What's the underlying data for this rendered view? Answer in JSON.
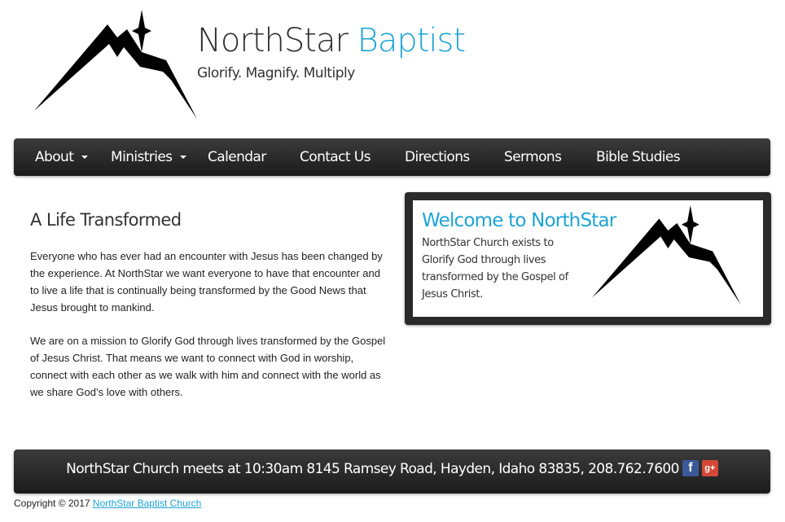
{
  "header": {
    "title_main": "NorthStar",
    "title_accent": "Baptist",
    "tagline": "Glorify. Magnify. Multiply",
    "logo_icon": "mountain-star-logo-icon"
  },
  "nav": {
    "items": [
      {
        "label": "About",
        "has_dropdown": true
      },
      {
        "label": "Ministries",
        "has_dropdown": true
      },
      {
        "label": "Calendar",
        "has_dropdown": false
      },
      {
        "label": "Contact Us",
        "has_dropdown": false
      },
      {
        "label": "Directions",
        "has_dropdown": false
      },
      {
        "label": "Sermons",
        "has_dropdown": false
      },
      {
        "label": "Bible Studies",
        "has_dropdown": false
      }
    ]
  },
  "main": {
    "title": "A Life Transformed",
    "paragraphs": [
      "Everyone who has ever had an encounter with Jesus has been changed by the experience. At NorthStar we want everyone to have that encounter and to live a life that is continually being transformed by the Good News that Jesus brought to mankind.",
      "We are on a mission to Glorify God through lives transformed by the Gospel of Jesus Christ. That means we want to connect with God in worship, connect with each other as we walk with him and connect with the world as we share God’s love with others."
    ]
  },
  "welcome": {
    "title": "Welcome to NorthStar",
    "text": "NorthStar Church exists to Glorify God through lives transformed by the Gospel of Jesus Christ."
  },
  "footer": {
    "text": "NorthStar Church meets at 10:30am 8145 Ramsey Road, Hayden, Idaho 83835, 208.762.7600",
    "social": {
      "facebook_label": "f",
      "googleplus_label": "g+"
    }
  },
  "copyright": {
    "prefix": "Copyright © 2017",
    "link_text": "NorthStar Baptist Church"
  },
  "colors": {
    "accent": "#1ea4d6",
    "nav_bg": "#2a2a2a",
    "facebook": "#3b5998",
    "googleplus": "#d34836"
  }
}
